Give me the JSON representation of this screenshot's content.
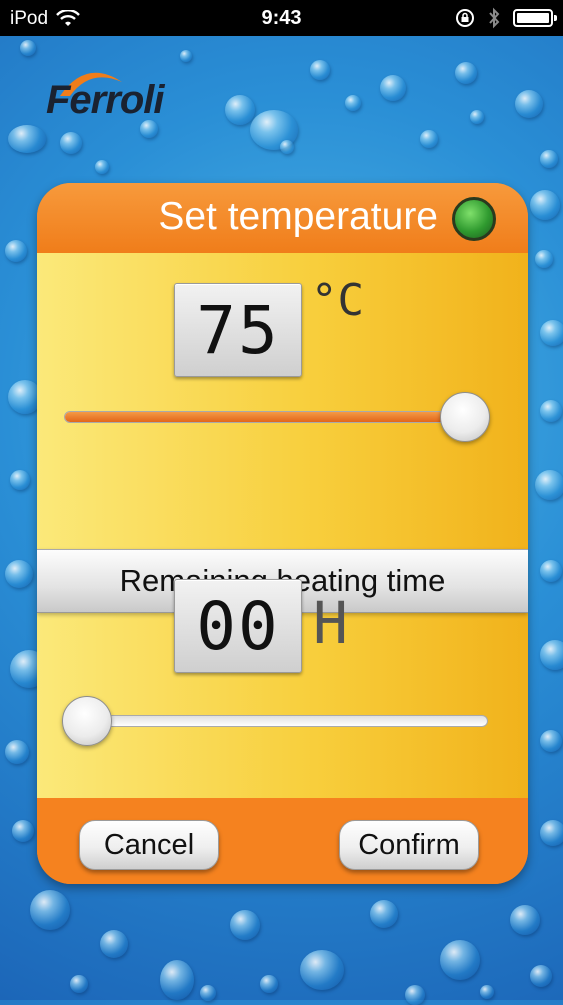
{
  "status_bar": {
    "device": "iPod",
    "time": "9:43"
  },
  "brand": {
    "logo_text": "Ferroli"
  },
  "panel": {
    "title": "Set temperature",
    "temperature": {
      "value": "75",
      "unit": "°C",
      "slider_level": 1.0
    },
    "heating_time_label": "Remaining heating time",
    "heating_time": {
      "value": "00",
      "unit": "H",
      "slider_level": 0.0
    },
    "buttons": {
      "cancel": "Cancel",
      "confirm": "Confirm"
    }
  },
  "colors": {
    "header": "#f5821f",
    "body_gradient_start": "#fbe97a",
    "body_gradient_end": "#f1b21b",
    "status_led": "#3fb23a",
    "background": "#2a8fd6"
  }
}
